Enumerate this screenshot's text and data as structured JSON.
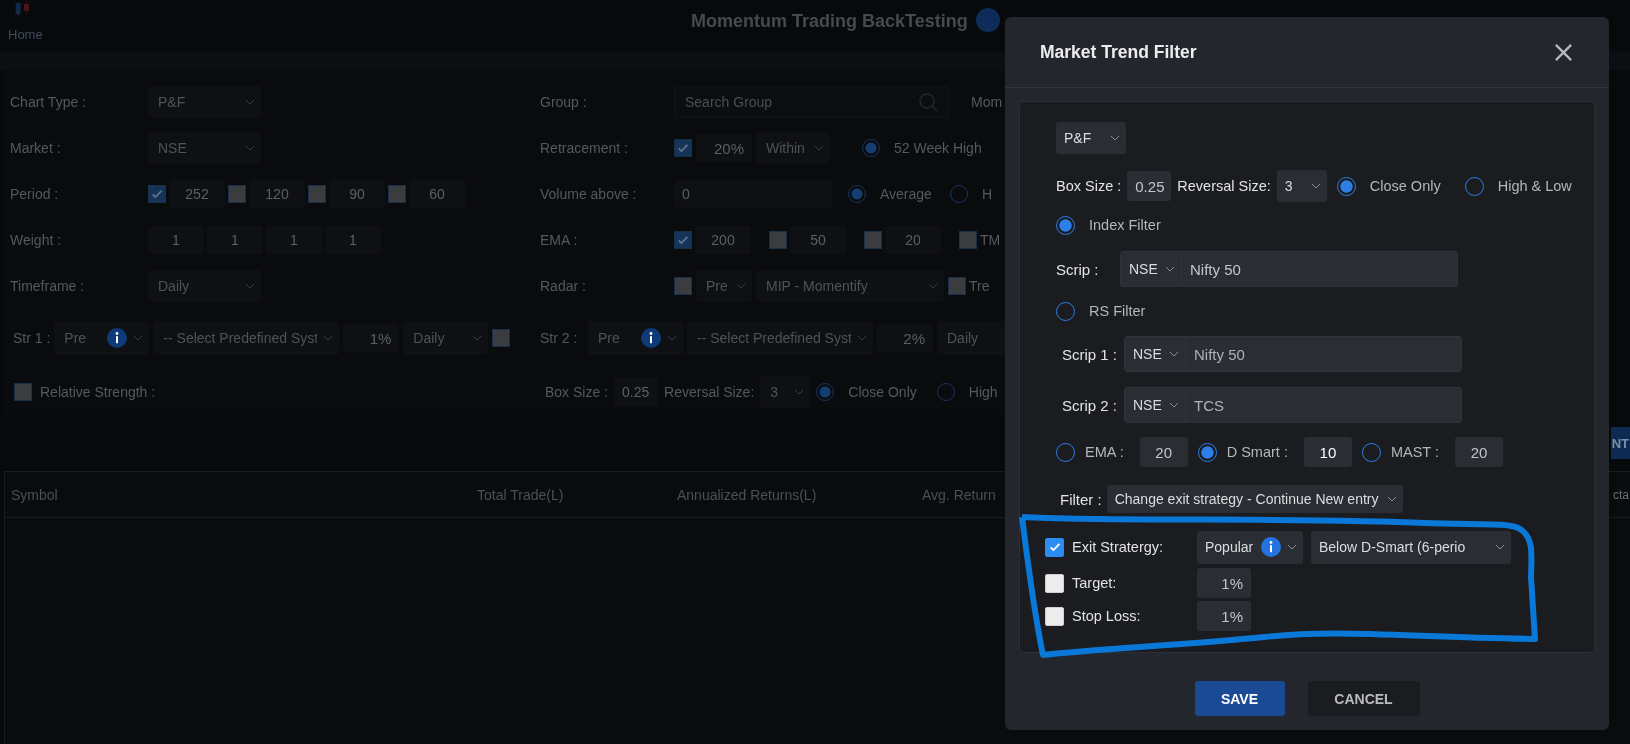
{
  "header": {
    "nav": "Home",
    "title": "Momentum Trading BackTesting"
  },
  "filters": {
    "left_rows": [
      {
        "kind": "select",
        "label": "Chart Type :",
        "value": "P&F"
      },
      {
        "kind": "select",
        "label": "Market :",
        "value": "NSE"
      },
      {
        "kind": "checks",
        "label": "Period :",
        "items": [
          {
            "checked": true,
            "value": "252"
          },
          {
            "checked": false,
            "value": "120"
          },
          {
            "checked": false,
            "value": "90"
          },
          {
            "checked": false,
            "value": "60"
          }
        ]
      },
      {
        "kind": "inputs",
        "label": "Weight :",
        "values": [
          "1",
          "1",
          "1",
          "1"
        ]
      },
      {
        "kind": "select",
        "label": "Timeframe :",
        "value": "Daily"
      }
    ],
    "right_rows": [
      {
        "kind": "search",
        "label": "Group :",
        "placeholder": "Search Group",
        "note": "Mom"
      },
      {
        "kind": "retracement",
        "label": "Retracement :",
        "checked": true,
        "value": "20%",
        "mode": "Within",
        "radios": [
          {
            "label": "52 Week High",
            "selected": true
          }
        ]
      },
      {
        "kind": "volume",
        "label": "Volume above :",
        "value": "0",
        "radios": [
          {
            "label": "Average",
            "selected": true
          },
          {
            "label": "H",
            "selected": false
          }
        ]
      },
      {
        "kind": "checks",
        "label": "EMA :",
        "items": [
          {
            "checked": true,
            "value": "200"
          },
          {
            "checked": false,
            "value": "50"
          },
          {
            "checked": false,
            "value": "20"
          }
        ],
        "extra": {
          "label": "TM",
          "checked": false
        }
      },
      {
        "kind": "radar",
        "label": "Radar :",
        "checked": false,
        "type": "Pre",
        "value": "MIP - Momentify",
        "extra": {
          "label": "Tre",
          "checked": false
        }
      }
    ],
    "strategies": [
      {
        "label": "Str 1 :",
        "type": "Pre",
        "system": "-- Select Predefined Syst",
        "percent": "1%",
        "timeframe": "Daily",
        "checked": false
      },
      {
        "label": "Str 2 :",
        "type": "Pre",
        "system": "-- Select Predefined Syst",
        "percent": "2%",
        "timeframe": "Daily"
      }
    ],
    "relative_strength": {
      "label": "Relative Strength :",
      "checked": false
    },
    "box_row": {
      "box_size_label": "Box Size :",
      "box_size": "0.25",
      "reversal_label": "Reversal Size:",
      "reversal": "3",
      "radios": [
        {
          "label": "Close Only",
          "selected": true
        },
        {
          "label": "High",
          "selected": false
        }
      ]
    }
  },
  "toolbar": {
    "button": "NT"
  },
  "table": {
    "columns": [
      "Symbol",
      "Total Trade(L)",
      "Annualized Returns(L)",
      "Avg. Return",
      "cta"
    ]
  },
  "modal": {
    "title": "Market Trend Filter",
    "chart_type": "P&F",
    "box_row": {
      "box_size_label": "Box Size :",
      "box_size": "0.25",
      "reversal_label": "Reversal Size:",
      "reversal": "3",
      "radios": [
        {
          "label": "Close Only",
          "selected": true
        },
        {
          "label": "High & Low",
          "selected": false
        }
      ]
    },
    "index_filter": {
      "label": "Index Filter",
      "selected": true,
      "scrip_label": "Scrip :",
      "market": "NSE",
      "value": "Nifty 50"
    },
    "rs_filter": {
      "label": "RS Filter",
      "selected": false,
      "scrips": [
        {
          "label": "Scrip 1 :",
          "market": "NSE",
          "value": "Nifty 50"
        },
        {
          "label": "Scrip 2 :",
          "market": "NSE",
          "value": "TCS"
        }
      ]
    },
    "averages": [
      {
        "label": "EMA :",
        "value": "20",
        "selected": false
      },
      {
        "label": "D Smart :",
        "value": "10",
        "selected": true
      },
      {
        "label": "MAST :",
        "value": "20",
        "selected": false
      }
    ],
    "filter": {
      "label": "Filter :",
      "value": "Change exit strategy - Continue New entry"
    },
    "exits": [
      {
        "kind": "strategy",
        "label": "Exit Stratergy:",
        "checked": true,
        "type": "Popular",
        "value": "Below D-Smart (6-perio"
      },
      {
        "kind": "percent",
        "label": "Target:",
        "checked": false,
        "value": "1%"
      },
      {
        "kind": "percent",
        "label": "Stop Loss:",
        "checked": false,
        "value": "1%"
      }
    ],
    "buttons": [
      {
        "kind": "primary",
        "label": "SAVE"
      },
      {
        "kind": "secondary",
        "label": "CANCEL"
      }
    ]
  }
}
